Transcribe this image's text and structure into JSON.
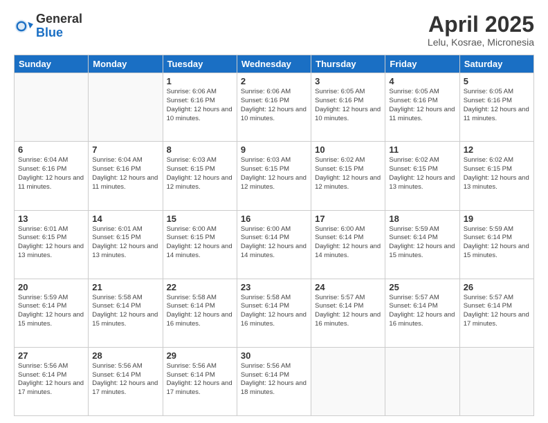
{
  "header": {
    "logo_general": "General",
    "logo_blue": "Blue",
    "month_title": "April 2025",
    "location": "Lelu, Kosrae, Micronesia"
  },
  "weekdays": [
    "Sunday",
    "Monday",
    "Tuesday",
    "Wednesday",
    "Thursday",
    "Friday",
    "Saturday"
  ],
  "weeks": [
    [
      {
        "day": "",
        "info": ""
      },
      {
        "day": "",
        "info": ""
      },
      {
        "day": "1",
        "info": "Sunrise: 6:06 AM\nSunset: 6:16 PM\nDaylight: 12 hours and 10 minutes."
      },
      {
        "day": "2",
        "info": "Sunrise: 6:06 AM\nSunset: 6:16 PM\nDaylight: 12 hours and 10 minutes."
      },
      {
        "day": "3",
        "info": "Sunrise: 6:05 AM\nSunset: 6:16 PM\nDaylight: 12 hours and 10 minutes."
      },
      {
        "day": "4",
        "info": "Sunrise: 6:05 AM\nSunset: 6:16 PM\nDaylight: 12 hours and 11 minutes."
      },
      {
        "day": "5",
        "info": "Sunrise: 6:05 AM\nSunset: 6:16 PM\nDaylight: 12 hours and 11 minutes."
      }
    ],
    [
      {
        "day": "6",
        "info": "Sunrise: 6:04 AM\nSunset: 6:16 PM\nDaylight: 12 hours and 11 minutes."
      },
      {
        "day": "7",
        "info": "Sunrise: 6:04 AM\nSunset: 6:16 PM\nDaylight: 12 hours and 11 minutes."
      },
      {
        "day": "8",
        "info": "Sunrise: 6:03 AM\nSunset: 6:15 PM\nDaylight: 12 hours and 12 minutes."
      },
      {
        "day": "9",
        "info": "Sunrise: 6:03 AM\nSunset: 6:15 PM\nDaylight: 12 hours and 12 minutes."
      },
      {
        "day": "10",
        "info": "Sunrise: 6:02 AM\nSunset: 6:15 PM\nDaylight: 12 hours and 12 minutes."
      },
      {
        "day": "11",
        "info": "Sunrise: 6:02 AM\nSunset: 6:15 PM\nDaylight: 12 hours and 13 minutes."
      },
      {
        "day": "12",
        "info": "Sunrise: 6:02 AM\nSunset: 6:15 PM\nDaylight: 12 hours and 13 minutes."
      }
    ],
    [
      {
        "day": "13",
        "info": "Sunrise: 6:01 AM\nSunset: 6:15 PM\nDaylight: 12 hours and 13 minutes."
      },
      {
        "day": "14",
        "info": "Sunrise: 6:01 AM\nSunset: 6:15 PM\nDaylight: 12 hours and 13 minutes."
      },
      {
        "day": "15",
        "info": "Sunrise: 6:00 AM\nSunset: 6:15 PM\nDaylight: 12 hours and 14 minutes."
      },
      {
        "day": "16",
        "info": "Sunrise: 6:00 AM\nSunset: 6:14 PM\nDaylight: 12 hours and 14 minutes."
      },
      {
        "day": "17",
        "info": "Sunrise: 6:00 AM\nSunset: 6:14 PM\nDaylight: 12 hours and 14 minutes."
      },
      {
        "day": "18",
        "info": "Sunrise: 5:59 AM\nSunset: 6:14 PM\nDaylight: 12 hours and 15 minutes."
      },
      {
        "day": "19",
        "info": "Sunrise: 5:59 AM\nSunset: 6:14 PM\nDaylight: 12 hours and 15 minutes."
      }
    ],
    [
      {
        "day": "20",
        "info": "Sunrise: 5:59 AM\nSunset: 6:14 PM\nDaylight: 12 hours and 15 minutes."
      },
      {
        "day": "21",
        "info": "Sunrise: 5:58 AM\nSunset: 6:14 PM\nDaylight: 12 hours and 15 minutes."
      },
      {
        "day": "22",
        "info": "Sunrise: 5:58 AM\nSunset: 6:14 PM\nDaylight: 12 hours and 16 minutes."
      },
      {
        "day": "23",
        "info": "Sunrise: 5:58 AM\nSunset: 6:14 PM\nDaylight: 12 hours and 16 minutes."
      },
      {
        "day": "24",
        "info": "Sunrise: 5:57 AM\nSunset: 6:14 PM\nDaylight: 12 hours and 16 minutes."
      },
      {
        "day": "25",
        "info": "Sunrise: 5:57 AM\nSunset: 6:14 PM\nDaylight: 12 hours and 16 minutes."
      },
      {
        "day": "26",
        "info": "Sunrise: 5:57 AM\nSunset: 6:14 PM\nDaylight: 12 hours and 17 minutes."
      }
    ],
    [
      {
        "day": "27",
        "info": "Sunrise: 5:56 AM\nSunset: 6:14 PM\nDaylight: 12 hours and 17 minutes."
      },
      {
        "day": "28",
        "info": "Sunrise: 5:56 AM\nSunset: 6:14 PM\nDaylight: 12 hours and 17 minutes."
      },
      {
        "day": "29",
        "info": "Sunrise: 5:56 AM\nSunset: 6:14 PM\nDaylight: 12 hours and 17 minutes."
      },
      {
        "day": "30",
        "info": "Sunrise: 5:56 AM\nSunset: 6:14 PM\nDaylight: 12 hours and 18 minutes."
      },
      {
        "day": "",
        "info": ""
      },
      {
        "day": "",
        "info": ""
      },
      {
        "day": "",
        "info": ""
      }
    ]
  ]
}
